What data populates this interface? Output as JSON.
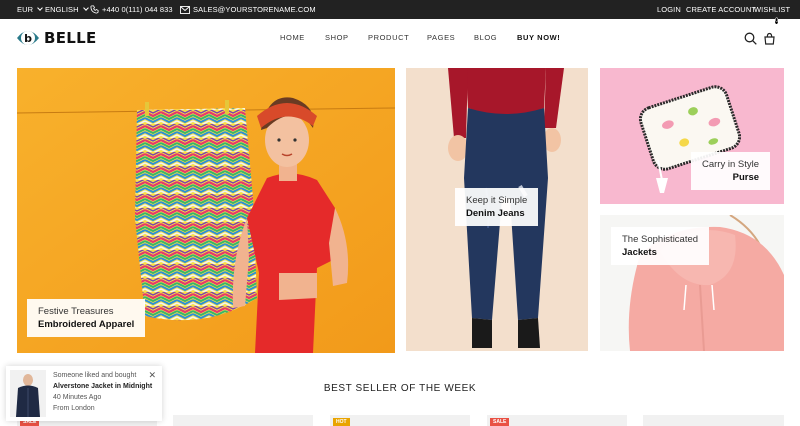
{
  "topbar": {
    "currency": "EUR",
    "language": "ENGLISH",
    "phone": "+440 0(111) 044 833",
    "email": "SALES@YOURSTORENAME.COM",
    "login": "LOGIN",
    "create_account": "CREATE ACCOUNT",
    "wishlist": "WISHLIST"
  },
  "header": {
    "logo_letter": "b",
    "logo_text": "BELLE",
    "nav": [
      "HOME",
      "SHOP",
      "PRODUCT",
      "PAGES",
      "BLOG",
      "BUY NOW!"
    ],
    "cart_count": "0",
    "search_icon": "search-icon",
    "cart_icon": "cart-icon"
  },
  "banners": [
    {
      "line1": "Festive Treasures",
      "line2": "Embroidered Apparel"
    },
    {
      "line1": "Keep it Simple",
      "line2": "Denim Jeans"
    },
    {
      "line1": "Carry in Style",
      "line2": "Purse"
    },
    {
      "line1": "The Sophisticated",
      "line2": "Jackets"
    }
  ],
  "section": {
    "title": "BEST SELLER OF THE WEEK"
  },
  "tags": [
    {
      "label": "SALE",
      "color": "#e95144"
    },
    {
      "label": "HOT",
      "color": "#e9a400"
    },
    {
      "label": "SALE",
      "color": "#e95144"
    }
  ],
  "toast": {
    "line1": "Someone liked and bought",
    "product": "Alverstone Jacket in Midnight",
    "time": "40 Minutes Ago",
    "location": "From London"
  },
  "colors": {
    "accent": "#2a7a8a",
    "topbar": "#222222"
  }
}
